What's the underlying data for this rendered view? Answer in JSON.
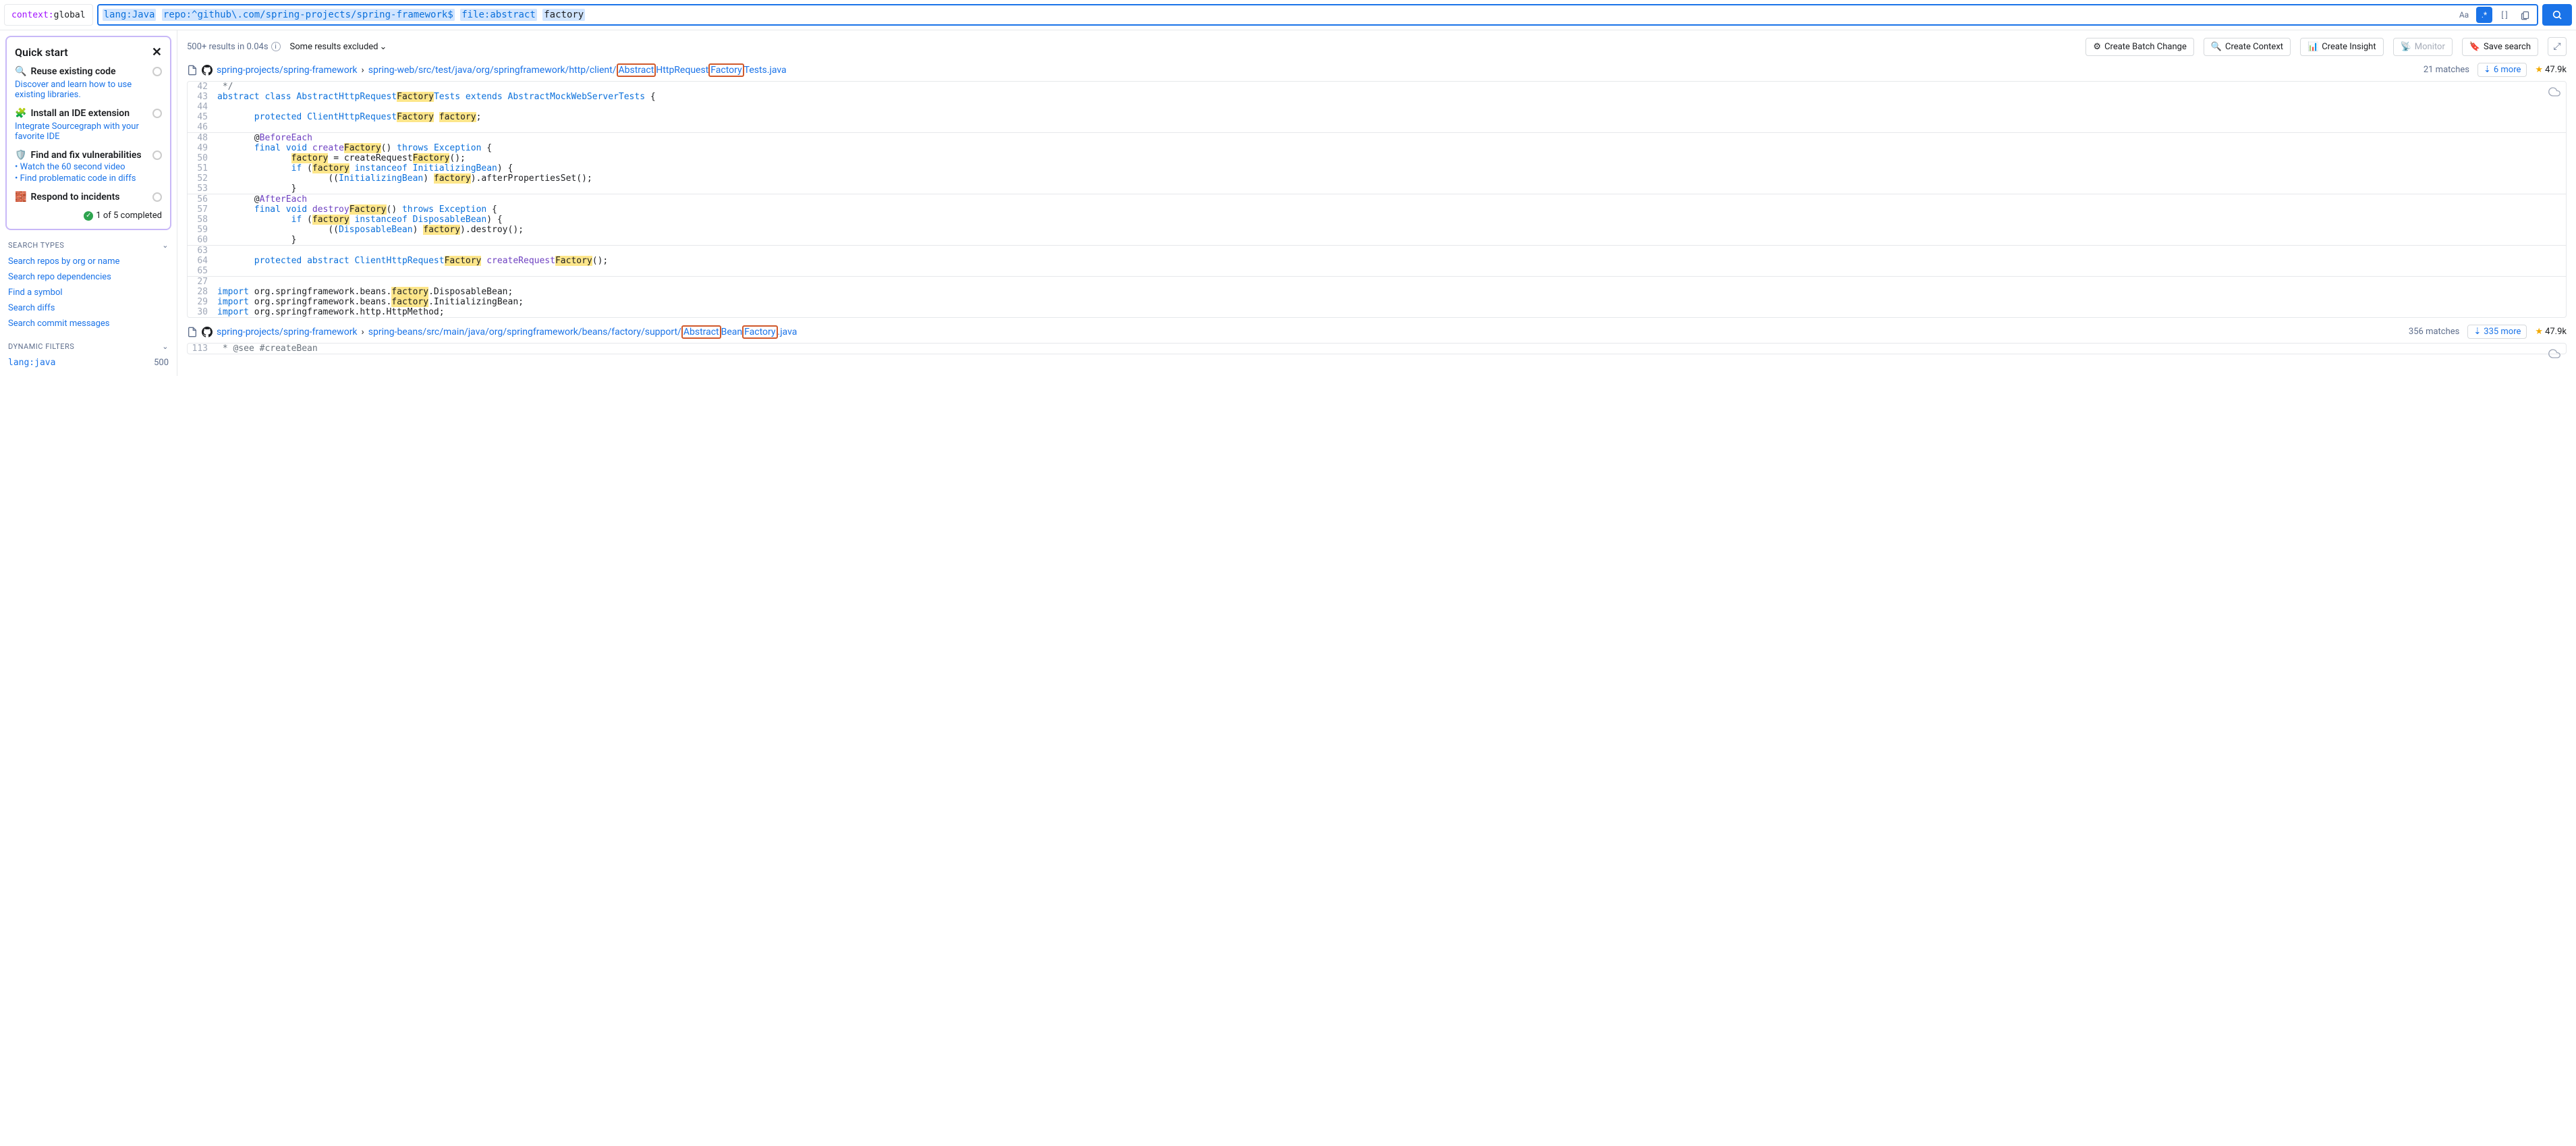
{
  "context": {
    "key": "context:",
    "val": "global"
  },
  "query": {
    "lang": "lang:Java",
    "repo": "repo:^github\\.com/spring-projects/spring-framework$",
    "file_key": "file:",
    "file_val": "abstract",
    "term": "factory"
  },
  "toolbar": {
    "aa": "Aa",
    "regex": ".*",
    "brackets": "[ ]"
  },
  "quickstart": {
    "title": "Quick start",
    "items": [
      {
        "icon": "🔍",
        "title": "Reuse existing code",
        "desc": "Discover and learn how to use existing libraries."
      },
      {
        "icon": "🧩",
        "title": "Install an IDE extension",
        "desc": "Integrate Sourcegraph with your favorite IDE"
      },
      {
        "icon": "🛡️",
        "title": "Find and fix vulnerabilities",
        "links": [
          "Watch the 60 second video",
          "Find problematic code in diffs"
        ]
      },
      {
        "icon": "🧱",
        "title": "Respond to incidents"
      }
    ],
    "completed": "1 of 5 completed"
  },
  "search_types": {
    "title": "SEARCH TYPES",
    "links": [
      "Search repos by org or name",
      "Search repo dependencies",
      "Find a symbol",
      "Search diffs",
      "Search commit messages"
    ]
  },
  "dynamic_filters": {
    "title": "DYNAMIC FILTERS",
    "items": [
      {
        "label": "lang:java",
        "count": "500"
      }
    ]
  },
  "results_bar": {
    "count": "500+ results in 0.04s",
    "excluded": "Some results excluded",
    "actions": {
      "batch": "Create Batch Change",
      "context": "Create Context",
      "insight": "Create Insight",
      "monitor": "Monitor",
      "save": "Save search"
    }
  },
  "result1": {
    "repo": "spring-projects/spring-framework",
    "sep": "›",
    "path_pre": "spring-web/src/test/java/org/springframework/http/client/",
    "hl1": "Abstract",
    "mid1": "HttpRequest",
    "hl2": "Factory",
    "post": "Tests.java",
    "matches": "21 matches",
    "more": "6 more",
    "stars": "47.9k"
  },
  "result2": {
    "repo": "spring-projects/spring-framework",
    "sep": "›",
    "path_pre": "spring-beans/src/main/java/org/springframework/beans/factory/support/",
    "hl1": "Abstract",
    "mid1": "Bean",
    "hl2": "Factory",
    "post": ".java",
    "matches": "356 matches",
    "more": "335 more",
    "stars": "47.9k"
  },
  "code1": [
    {
      "n": "42",
      "h": " */",
      "cls": "cm"
    },
    {
      "n": "43",
      "h": "<span class='kw'>abstract</span> <span class='kw'>class</span> <span class='cls'>AbstractHttpRequest</span><span class='hl'>Factory</span><span class='cls'>Tests</span> <span class='kw'>extends</span> <span class='cls'>AbstractMockWebServerTests</span> {"
    },
    {
      "n": "44",
      "h": ""
    },
    {
      "n": "45",
      "h": "       <span class='kw'>protected</span> <span class='cls'>ClientHttpRequest</span><span class='hl'>Factory</span> <span class='hl'>factory</span>;"
    },
    {
      "n": "46",
      "h": ""
    }
  ],
  "code2": [
    {
      "n": "48",
      "h": "       @<span class='fn'>BeforeEach</span>"
    },
    {
      "n": "49",
      "h": "       <span class='kw'>final</span> <span class='kw'>void</span> <span class='fn'>create</span><span class='hl'>Factory</span>() <span class='kw'>throws</span> <span class='cls'>Exception</span> {"
    },
    {
      "n": "50",
      "h": "              <span class='hl'>factory</span> = createRequest<span class='hl'>Factory</span>();"
    },
    {
      "n": "51",
      "h": "              <span class='kw'>if</span> (<span class='hl'>factory</span> <span class='kw'>instanceof</span> <span class='cls'>InitializingBean</span>) {"
    },
    {
      "n": "52",
      "h": "                     ((<span class='cls'>InitializingBean</span>) <span class='hl'>factory</span>).afterPropertiesSet();"
    },
    {
      "n": "53",
      "h": "              }"
    }
  ],
  "code3": [
    {
      "n": "56",
      "h": "       @<span class='fn'>AfterEach</span>"
    },
    {
      "n": "57",
      "h": "       <span class='kw'>final</span> <span class='kw'>void</span> <span class='fn'>destroy</span><span class='hl'>Factory</span>() <span class='kw'>throws</span> <span class='cls'>Exception</span> {"
    },
    {
      "n": "58",
      "h": "              <span class='kw'>if</span> (<span class='hl'>factory</span> <span class='kw'>instanceof</span> <span class='cls'>DisposableBean</span>) {"
    },
    {
      "n": "59",
      "h": "                     ((<span class='cls'>DisposableBean</span>) <span class='hl'>factory</span>).destroy();"
    },
    {
      "n": "60",
      "h": "              }"
    }
  ],
  "code4": [
    {
      "n": "63",
      "h": ""
    },
    {
      "n": "64",
      "h": "       <span class='kw'>protected</span> <span class='kw'>abstract</span> <span class='cls'>ClientHttpRequest</span><span class='hl'>Factory</span> <span class='fn'>createRequest</span><span class='hl'>Factory</span>();"
    },
    {
      "n": "65",
      "h": ""
    }
  ],
  "code5": [
    {
      "n": "27",
      "h": ""
    },
    {
      "n": "28",
      "h": "<span class='kw'>import</span> org.springframework.beans.<span class='hl'>factory</span>.DisposableBean;"
    },
    {
      "n": "29",
      "h": "<span class='kw'>import</span> org.springframework.beans.<span class='hl'>factory</span>.InitializingBean;"
    },
    {
      "n": "30",
      "h": "<span class='kw'>import</span> org.springframework.http.HttpMethod;"
    }
  ],
  "code6": [
    {
      "n": "113",
      "h": " * @see #createBean",
      "cls": "cm"
    }
  ]
}
